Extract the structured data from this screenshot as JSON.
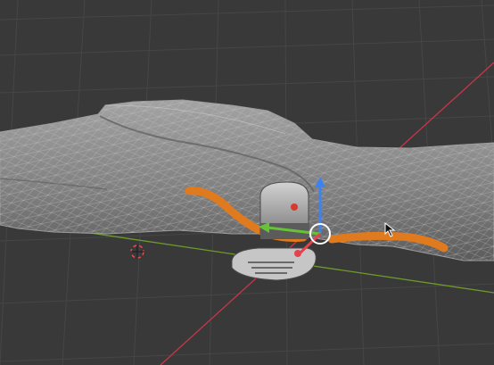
{
  "viewport": {
    "background_color": "#393939",
    "grid_color": "#474747",
    "x_axis_color": "#c8364a",
    "y_axis_color": "#6f9a2a",
    "mesh_color": "#8c8c8c",
    "mesh_wire_color": "#b9b9b9",
    "selection_color": "#e07a1f"
  },
  "objects": [
    {
      "name": "hand-scan-mesh",
      "kind": "mesh"
    },
    {
      "name": "wrist-device",
      "kind": "mesh"
    },
    {
      "name": "strap-selection",
      "kind": "selected-edges"
    }
  ],
  "gizmo": {
    "type": "move",
    "x_color": "#e5424f",
    "y_color": "#67c23a",
    "z_color": "#3d82f0",
    "center_color": "#ffffff"
  },
  "cursor_3d": {
    "icon": "3d-cursor-icon"
  },
  "mouse_pointer": {
    "icon": "arrow-pointer-icon"
  }
}
